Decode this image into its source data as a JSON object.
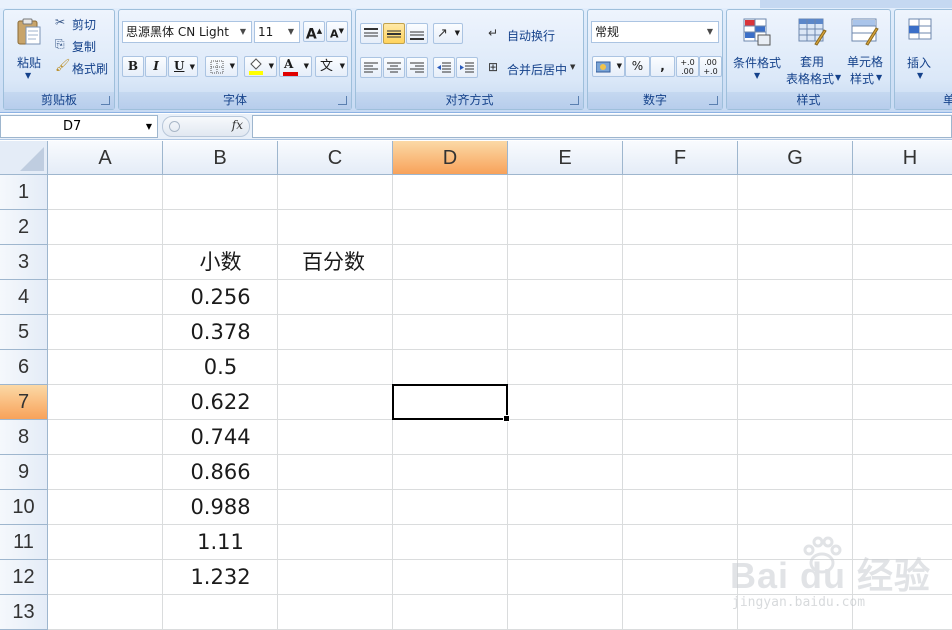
{
  "ribbon": {
    "clipboard": {
      "paste_label": "粘贴",
      "cut_label": "剪切",
      "copy_label": "复制",
      "format_painter_label": "格式刷",
      "group_label": "剪贴板"
    },
    "font": {
      "font_name": "思源黑体 CN Light",
      "font_size": "11",
      "grow_label": "A",
      "shrink_label": "A",
      "bold_label": "B",
      "italic_label": "I",
      "underline_label": "U",
      "font_color_label": "A",
      "phonetic_label": "文",
      "group_label": "字体"
    },
    "alignment": {
      "wrap_text_label": "自动换行",
      "merge_center_label": "合并后居中",
      "group_label": "对齐方式"
    },
    "number": {
      "format_value": "常规",
      "percent_label": "%",
      "comma_label": ",",
      "inc_decimal_label": "+.0 .00",
      "dec_decimal_label": ".00 +.0",
      "group_label": "数字"
    },
    "styles": {
      "conditional_format_label": "条件格式",
      "table_format_line1": "套用",
      "table_format_line2": "表格格式",
      "cell_styles_line1": "单元格",
      "cell_styles_line2": "样式",
      "group_label": "样式"
    },
    "cells": {
      "insert_label": "插入",
      "group_label": "单"
    }
  },
  "formula_bar": {
    "name_box": "D7",
    "fx_label": "fx",
    "formula": ""
  },
  "sheet": {
    "columns": [
      "A",
      "B",
      "C",
      "D",
      "E",
      "F",
      "G",
      "H"
    ],
    "rows": [
      "1",
      "2",
      "3",
      "4",
      "5",
      "6",
      "7",
      "8",
      "9",
      "10",
      "11",
      "12",
      "13"
    ],
    "selected_column": "D",
    "selected_row": "7",
    "cells": {
      "B3": "小数",
      "C3": "百分数",
      "B4": "0.256",
      "B5": "0.378",
      "B6": "0.5",
      "B7": "0.622",
      "B8": "0.744",
      "B9": "0.866",
      "B10": "0.988",
      "B11": "1.11",
      "B12": "1.232"
    }
  },
  "watermark": {
    "brand": "Bai du 经验",
    "url": "jingyan.baidu.com"
  },
  "colors": {
    "ribbon_bg": "#dbe8f8",
    "selected_header": "#f8a25a",
    "gridline": "#dadcdd",
    "label_text": "#15428b"
  }
}
